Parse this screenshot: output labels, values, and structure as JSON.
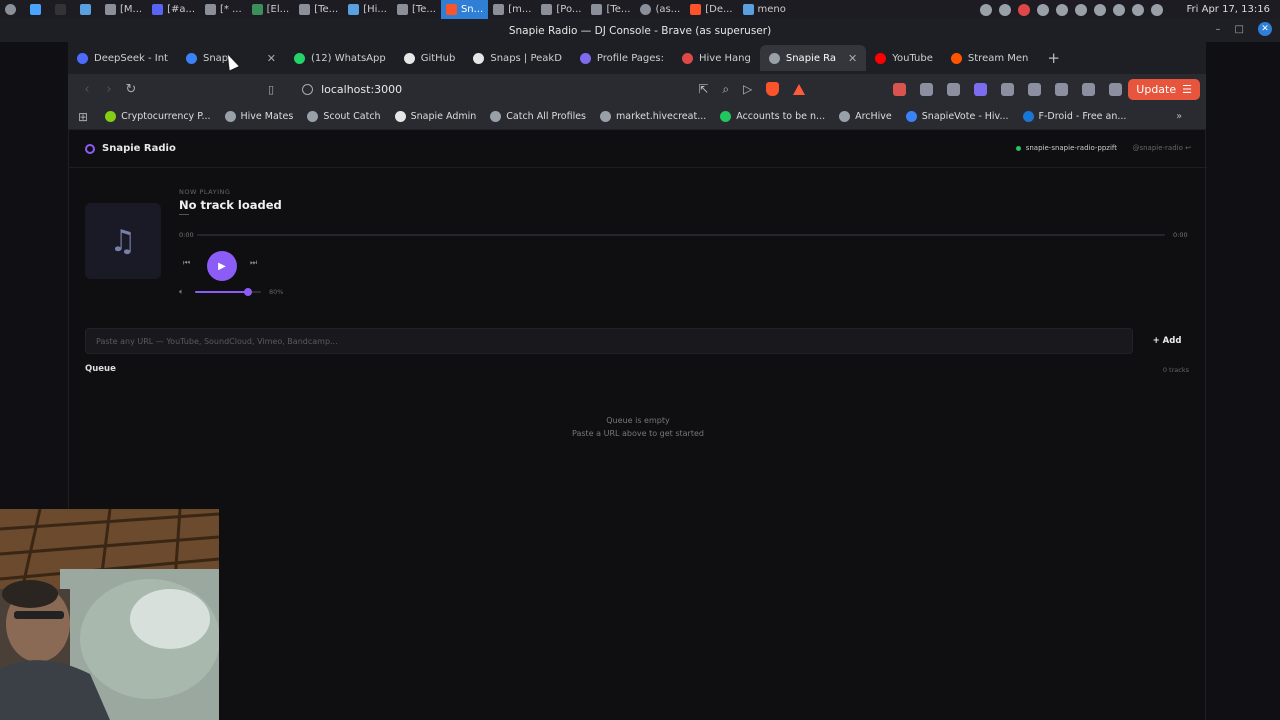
{
  "taskbar": {
    "items": [
      "",
      "",
      "",
      "",
      "[M...",
      "[#a...",
      "[* ...",
      "[El...",
      "[Te...",
      "[Hi...",
      "[Te...",
      "Sn...",
      "[m...",
      "[Po...",
      "[Te...",
      "(as...",
      "[De...",
      "meno"
    ],
    "active_index": 11,
    "clock": "Fri Apr 17, 13:16"
  },
  "window": {
    "title": "Snapie Radio — DJ Console - Brave (as superuser)"
  },
  "tabs": [
    {
      "label": "DeepSeek - Int",
      "favicon_color": "#4d6bfe"
    },
    {
      "label": "Snap",
      "favicon_color": "#3b82f6",
      "closable": true
    },
    {
      "label": "(12) WhatsApp",
      "favicon_color": "#25d366"
    },
    {
      "label": "GitHub",
      "favicon_color": "#e6e6e6"
    },
    {
      "label": "Snaps | PeakD",
      "favicon_color": "#e6e6e6"
    },
    {
      "label": "Profile Pages:",
      "favicon_color": "#7c6cf0"
    },
    {
      "label": "Hive Hang",
      "favicon_color": "#e04848"
    },
    {
      "label": "Snapie Ra",
      "favicon_color": "#9aa0a8",
      "active": true,
      "closable": true
    },
    {
      "label": "YouTube",
      "favicon_color": "#ff0000"
    },
    {
      "label": "Stream Men",
      "favicon_color": "#ff5500"
    }
  ],
  "navbar": {
    "url": "localhost:3000",
    "update_label": "Update"
  },
  "bookmarks": [
    {
      "label": "Cryptocurrency P...",
      "icon_color": "#84cc16"
    },
    {
      "label": "Hive Mates",
      "icon_color": "#9aa0a8"
    },
    {
      "label": "Scout Catch",
      "icon_color": "#9aa0a8"
    },
    {
      "label": "Snapie Admin",
      "icon_color": "#e6e6e6"
    },
    {
      "label": "Catch All Profiles",
      "icon_color": "#9aa0a8"
    },
    {
      "label": "market.hivecreat...",
      "icon_color": "#9aa0a8"
    },
    {
      "label": "Accounts to be n...",
      "icon_color": "#22c55e"
    },
    {
      "label": "ArcHive",
      "icon_color": "#9aa0a8"
    },
    {
      "label": "SnapieVote - Hiv...",
      "icon_color": "#3b82f6"
    },
    {
      "label": "F-Droid - Free an...",
      "icon_color": "#1976d2"
    }
  ],
  "app": {
    "brand": "Snapie Radio",
    "room": "snapie-snapie-radio-ppzift",
    "user": "@snapie-radio",
    "accent_color": "#8b5cf6"
  },
  "player": {
    "now_playing_label": "NOW PLAYING",
    "track_title": "No track loaded",
    "time_current": "0:00",
    "time_total": "0:00",
    "progress": 0,
    "volume": 0.8,
    "volume_label": "80%"
  },
  "add": {
    "placeholder": "Paste any URL — YouTube, SoundCloud, Vimeo, Bandcamp...",
    "button_label": "+ Add"
  },
  "queue": {
    "title": "Queue",
    "count_label": "0 tracks",
    "empty_title": "Queue is empty",
    "empty_hint": "Paste a URL above to get started"
  }
}
